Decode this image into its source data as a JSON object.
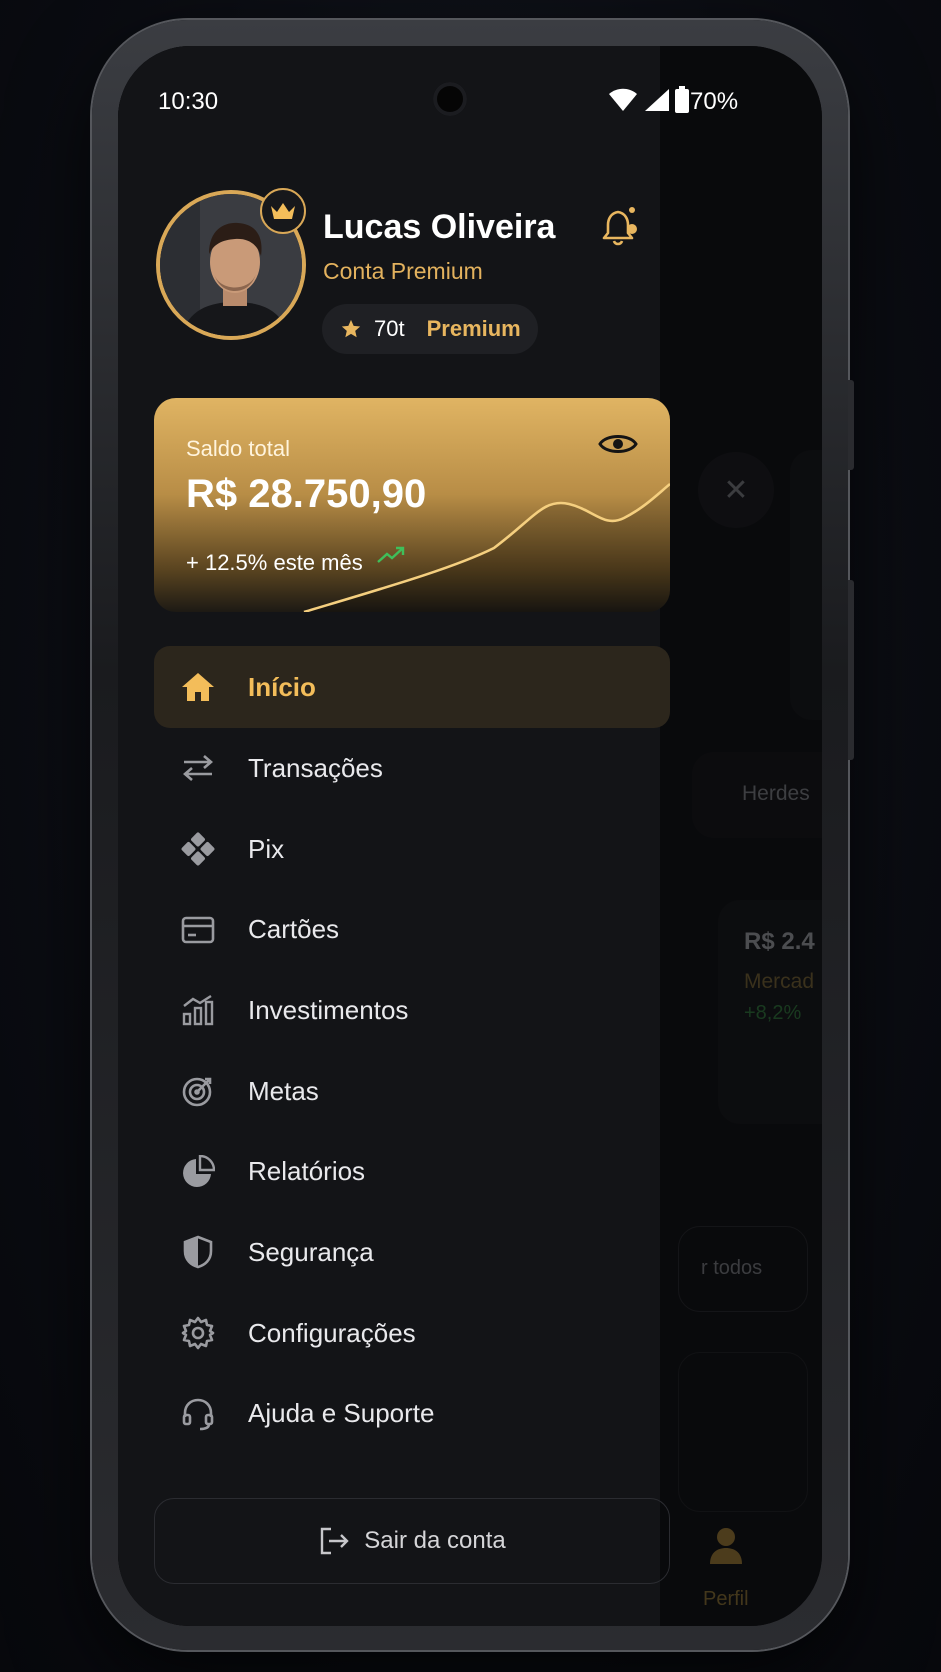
{
  "status_bar": {
    "time": "10:30",
    "battery": "70%"
  },
  "profile": {
    "name": "Lucas Oliveira",
    "tier": "Conta Premium",
    "points": "70t",
    "level": "Premium"
  },
  "balance_card": {
    "label": "Saldo total",
    "amount": "R$ 28.750,90",
    "change": "+ 12.5% este mês"
  },
  "menu": {
    "items": [
      {
        "label": "Início",
        "icon": "home-icon",
        "active": true
      },
      {
        "label": "Transações",
        "icon": "transfer-arrows-icon"
      },
      {
        "label": "Pix",
        "icon": "pix-icon"
      },
      {
        "label": "Cartões",
        "icon": "card-icon"
      },
      {
        "label": "Investimentos",
        "icon": "bar-chart-icon"
      },
      {
        "label": "Metas",
        "icon": "target-icon"
      },
      {
        "label": "Relatórios",
        "icon": "pie-chart-icon"
      },
      {
        "label": "Segurança",
        "icon": "shield-icon"
      },
      {
        "label": "Configurações",
        "icon": "gear-icon"
      },
      {
        "label": "Ajuda e Suporte",
        "icon": "headset-icon"
      }
    ]
  },
  "logout": {
    "label": "Sair da conta"
  },
  "background_app": {
    "chip": "Herdes",
    "card_value": "R$ 2.4",
    "card_name": "Mercad",
    "card_change": "+8,2%",
    "see_all": "r todos",
    "nav_profile": "Perfil"
  },
  "colors": {
    "accent": "#f3bd5a",
    "gold": "#d9a857",
    "bg": "#131417",
    "positive": "#3fbf5a"
  }
}
